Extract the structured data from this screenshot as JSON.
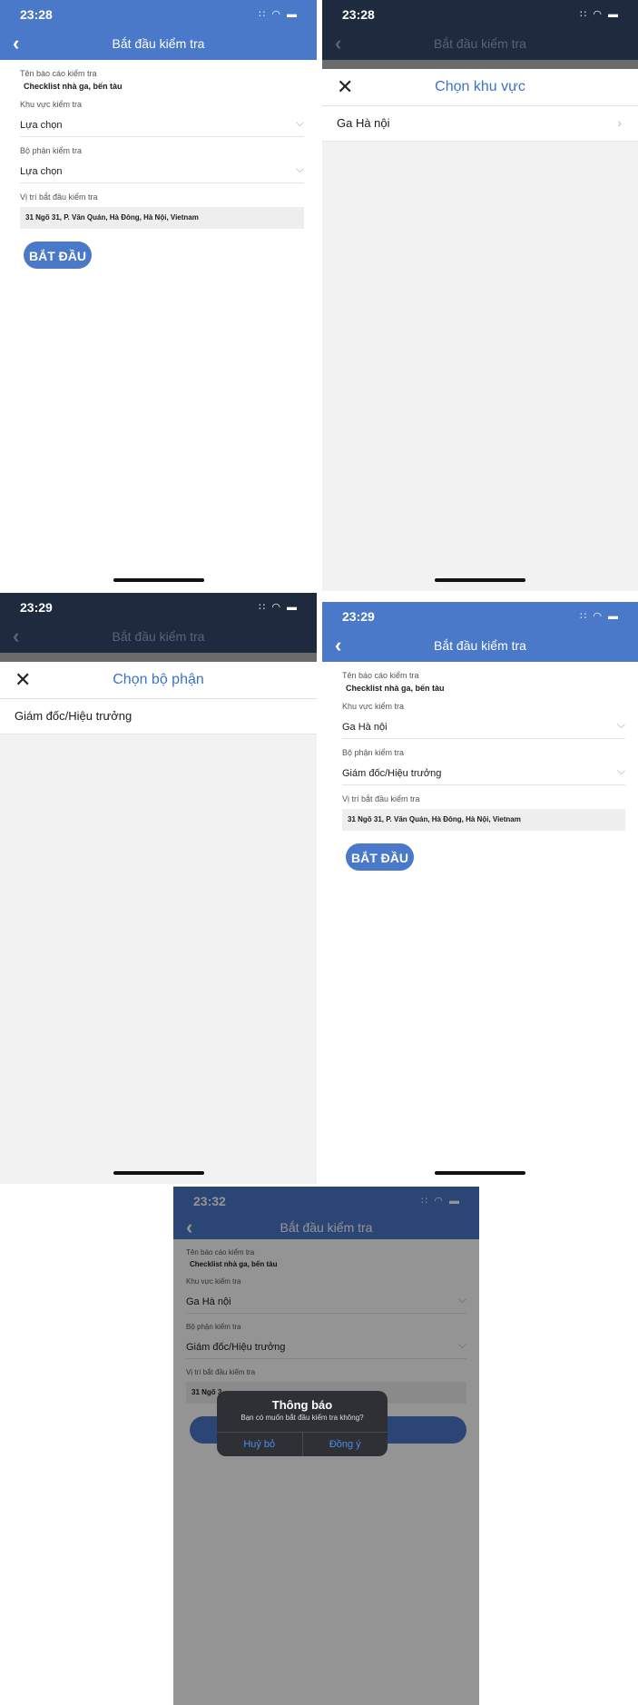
{
  "common": {
    "screen_title": "Bắt đầu kiểm tra",
    "report_name_label": "Tên báo cáo kiểm tra",
    "report_name_value": "Checklist nhà ga, bến tàu",
    "area_label": "Khu vực kiểm tra",
    "dept_label": "Bộ phận kiểm tra",
    "location_label": "Vị trí bắt đầu kiểm tra",
    "location_value": "31 Ngõ 31, P. Văn Quán, Hà Đông, Hà Nội, Vietnam",
    "start_button": "BẮT ĐẦU",
    "status_icons": "∷ ◠ ▬"
  },
  "screen1": {
    "time": "23:28",
    "area_value": "Lựa chọn",
    "dept_value": "Lựa chọn"
  },
  "screen2": {
    "time": "23:28",
    "sheet_title": "Chọn khu vực",
    "option": "Ga Hà nội"
  },
  "screen3": {
    "time": "23:29",
    "sheet_title": "Chọn bộ phận",
    "option": "Giám đốc/Hiệu trưởng"
  },
  "screen4": {
    "time": "23:29",
    "area_value": "Ga Hà nội",
    "dept_value": "Giám đốc/Hiệu trưởng"
  },
  "screen5": {
    "time": "23:32",
    "area_value": "Ga Hà nội",
    "dept_value": "Giám đốc/Hiệu trưởng",
    "location_partial": "31 Ngõ 3",
    "dialog_title": "Thông báo",
    "dialog_message": "Bạn có muốn bắt đầu kiểm tra không?",
    "cancel": "Huỷ bỏ",
    "confirm": "Đồng ý"
  },
  "colors": {
    "primary": "#4a79c9",
    "dark_header": "#1e2a3e",
    "sheet_title": "#3b73c8",
    "dialog_button": "#4d8de6"
  }
}
